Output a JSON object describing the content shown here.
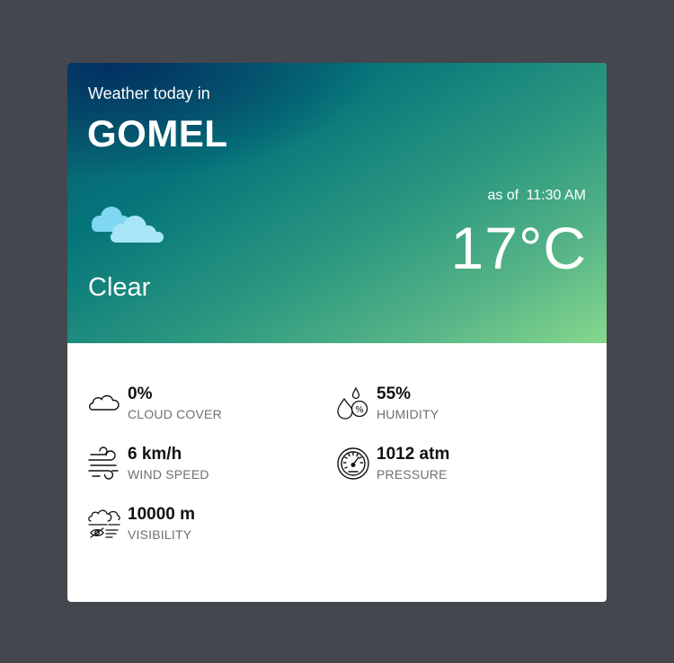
{
  "header": {
    "subtitle": "Weather today in",
    "city": "GOMEL",
    "condition": "Clear",
    "as_of_prefix": "as of",
    "time": "11:30 AM",
    "temperature": "17°C",
    "icon": "clouds-icon"
  },
  "stats": [
    {
      "value": "0%",
      "label": "CLOUD COVER",
      "icon": "cloud-outline-icon"
    },
    {
      "value": "55%",
      "label": "HUMIDITY",
      "icon": "humidity-icon"
    },
    {
      "value": "6 km/h",
      "label": "WIND SPEED",
      "icon": "wind-icon"
    },
    {
      "value": "1012 atm",
      "label": "PRESSURE",
      "icon": "gauge-icon"
    },
    {
      "value": "10000 m",
      "label": "VISIBILITY",
      "icon": "visibility-icon"
    }
  ],
  "colors": {
    "background": "#44474e",
    "card": "#ffffff",
    "cloud_light": "#9fe3f7",
    "gradient_start": "#002a5f",
    "gradient_end": "#86d88c"
  }
}
